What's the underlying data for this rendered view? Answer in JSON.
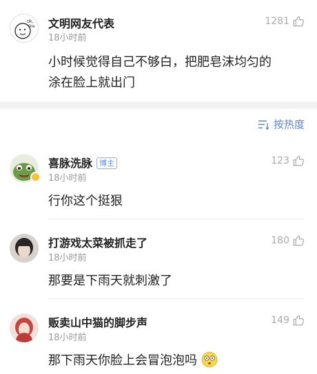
{
  "top_comment": {
    "author": "文明网友代表",
    "time": "18小时前",
    "likes": "1281",
    "text_line1": "小时候觉得自己不够白，把肥皂沫均匀的",
    "text_line2": "涂在脸上就出门"
  },
  "sort": {
    "label": "按热度"
  },
  "replies": [
    {
      "author": "喜脉洗脉",
      "badge": "博主",
      "time": "18小时前",
      "likes": "123",
      "text": "行你这个挺狠"
    },
    {
      "author": "打游戏太菜被抓走了",
      "time": "18小时前",
      "likes": "180",
      "text": "那要是下雨天就刺激了"
    },
    {
      "author": "贩卖山中猫的脚步声",
      "time": "18小时前",
      "likes": "149",
      "text": "那下雨天你脸上会冒泡泡吗"
    }
  ],
  "icons": {
    "like": "thumbs-up-icon",
    "sort": "sort-icon",
    "emoji": "dizzy-face-emoji"
  },
  "colors": {
    "accent": "#5b86c9",
    "muted": "#999999"
  }
}
